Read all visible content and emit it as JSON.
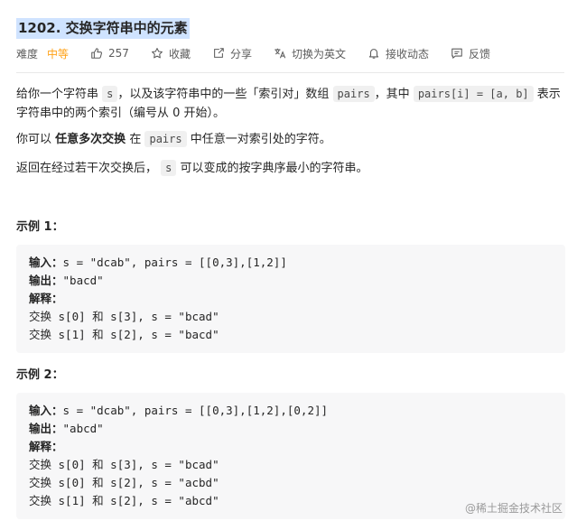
{
  "problem": {
    "title": "1202. 交换字符串中的元素"
  },
  "meta": {
    "difficulty_label": "难度",
    "difficulty_value": "中等",
    "likes": "257",
    "favorite_label": "收藏",
    "share_label": "分享",
    "translate_label": "切换为英文",
    "notify_label": "接收动态",
    "feedback_label": "反馈"
  },
  "description": {
    "p1_a": "给你一个字符串",
    "p1_code1": "s",
    "p1_b": "，以及该字符串中的一些「索引对」数组",
    "p1_code2": "pairs",
    "p1_c": "，其中",
    "p1_code3": "pairs[i] = [a, b]",
    "p1_d": "表示字符串中的两个索引（编号从 0 开始）。",
    "p2_a": "你可以",
    "p2_bold": "任意多次交换",
    "p2_b": "在",
    "p2_code": "pairs",
    "p2_c": "中任意一对索引处的字符。",
    "p3_a": "返回在经过若干次交换后，",
    "p3_code": "s",
    "p3_b": "可以变成的按字典序最小的字符串。"
  },
  "examples": [
    {
      "title": "示例 1：",
      "input_label": "输入：",
      "input": "s = \"dcab\", pairs = [[0,3],[1,2]]",
      "output_label": "输出：",
      "output": "\"bacd\"",
      "explain_label": "解释：",
      "steps": [
        "交换 s[0] 和 s[3], s = \"bcad\"",
        "交换 s[1] 和 s[2], s = \"bacd\""
      ]
    },
    {
      "title": "示例 2：",
      "input_label": "输入：",
      "input": "s = \"dcab\", pairs = [[0,3],[1,2],[0,2]]",
      "output_label": "输出：",
      "output": "\"abcd\"",
      "explain_label": "解释：",
      "steps": [
        "交换 s[0] 和 s[3], s = \"bcad\"",
        "交换 s[0] 和 s[2], s = \"acbd\"",
        "交换 s[1] 和 s[2], s = \"abcd\""
      ]
    }
  ],
  "watermark": "@稀土掘金技术社区"
}
